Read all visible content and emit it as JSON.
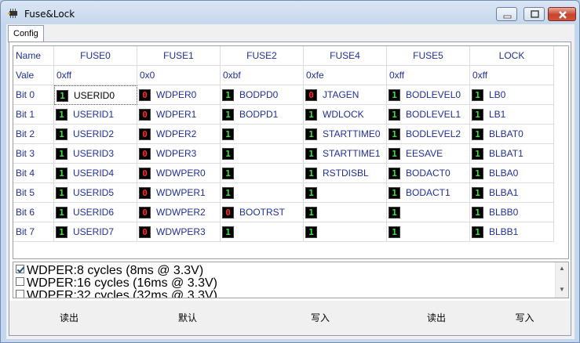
{
  "window": {
    "title": "Fuse&Lock"
  },
  "tabs": [
    {
      "label": "Config"
    }
  ],
  "grid": {
    "headers": [
      "Name",
      "FUSE0",
      "FUSE1",
      "FUSE2",
      "FUSE4",
      "FUSE5",
      "LOCK"
    ],
    "value_label": "Vale",
    "values": [
      "0xff",
      "0x0",
      "0xbf",
      "0xfe",
      "0xff",
      "0xff"
    ],
    "rows": [
      {
        "name": "Bit 0",
        "cells": [
          {
            "bit": "1",
            "label": "USERID0"
          },
          {
            "bit": "0",
            "label": "WDPER0"
          },
          {
            "bit": "1",
            "label": "BODPD0"
          },
          {
            "bit": "0",
            "label": "JTAGEN"
          },
          {
            "bit": "1",
            "label": "BODLEVEL0"
          },
          {
            "bit": "1",
            "label": "LB0"
          }
        ]
      },
      {
        "name": "Bit 1",
        "cells": [
          {
            "bit": "1",
            "label": "USERID1"
          },
          {
            "bit": "0",
            "label": "WDPER1"
          },
          {
            "bit": "1",
            "label": "BODPD1"
          },
          {
            "bit": "1",
            "label": "WDLOCK"
          },
          {
            "bit": "1",
            "label": "BODLEVEL1"
          },
          {
            "bit": "1",
            "label": "LB1"
          }
        ]
      },
      {
        "name": "Bit 2",
        "cells": [
          {
            "bit": "1",
            "label": "USERID2"
          },
          {
            "bit": "0",
            "label": "WDPER2"
          },
          {
            "bit": "1",
            "label": ""
          },
          {
            "bit": "1",
            "label": "STARTTIME0"
          },
          {
            "bit": "1",
            "label": "BODLEVEL2"
          },
          {
            "bit": "1",
            "label": "BLBAT0"
          }
        ]
      },
      {
        "name": "Bit 3",
        "cells": [
          {
            "bit": "1",
            "label": "USERID3"
          },
          {
            "bit": "0",
            "label": "WDPER3"
          },
          {
            "bit": "1",
            "label": ""
          },
          {
            "bit": "1",
            "label": "STARTTIME1"
          },
          {
            "bit": "1",
            "label": "EESAVE"
          },
          {
            "bit": "1",
            "label": "BLBAT1"
          }
        ]
      },
      {
        "name": "Bit 4",
        "cells": [
          {
            "bit": "1",
            "label": "USERID4"
          },
          {
            "bit": "0",
            "label": "WDWPER0"
          },
          {
            "bit": "1",
            "label": ""
          },
          {
            "bit": "1",
            "label": "RSTDISBL"
          },
          {
            "bit": "1",
            "label": "BODACT0"
          },
          {
            "bit": "1",
            "label": "BLBA0"
          }
        ]
      },
      {
        "name": "Bit 5",
        "cells": [
          {
            "bit": "1",
            "label": "USERID5"
          },
          {
            "bit": "0",
            "label": "WDWPER1"
          },
          {
            "bit": "1",
            "label": ""
          },
          {
            "bit": "1",
            "label": ""
          },
          {
            "bit": "1",
            "label": "BODACT1"
          },
          {
            "bit": "1",
            "label": "BLBA1"
          }
        ]
      },
      {
        "name": "Bit 6",
        "cells": [
          {
            "bit": "1",
            "label": "USERID6"
          },
          {
            "bit": "0",
            "label": "WDWPER2"
          },
          {
            "bit": "0",
            "label": "BOOTRST"
          },
          {
            "bit": "1",
            "label": ""
          },
          {
            "bit": "1",
            "label": ""
          },
          {
            "bit": "1",
            "label": "BLBB0"
          }
        ]
      },
      {
        "name": "Bit 7",
        "cells": [
          {
            "bit": "1",
            "label": "USERID7"
          },
          {
            "bit": "0",
            "label": "WDWPER3"
          },
          {
            "bit": "1",
            "label": ""
          },
          {
            "bit": "1",
            "label": ""
          },
          {
            "bit": "1",
            "label": ""
          },
          {
            "bit": "1",
            "label": "BLBB1"
          }
        ]
      }
    ]
  },
  "options": [
    {
      "label": "WDPER:8 cycles (8ms @ 3.3V)",
      "checked": true
    },
    {
      "label": "WDPER:16 cycles (16ms @ 3.3V)",
      "checked": false
    },
    {
      "label": "WDPER:32 cycles (32ms @ 3.3V)",
      "checked": false
    }
  ],
  "buttons": [
    "读出",
    "默认",
    "写入",
    "读出",
    "写入"
  ],
  "colors": {
    "bit_on": "#3ee03e",
    "bit_off": "#ff2a2a",
    "text": "#1f2f9a"
  }
}
